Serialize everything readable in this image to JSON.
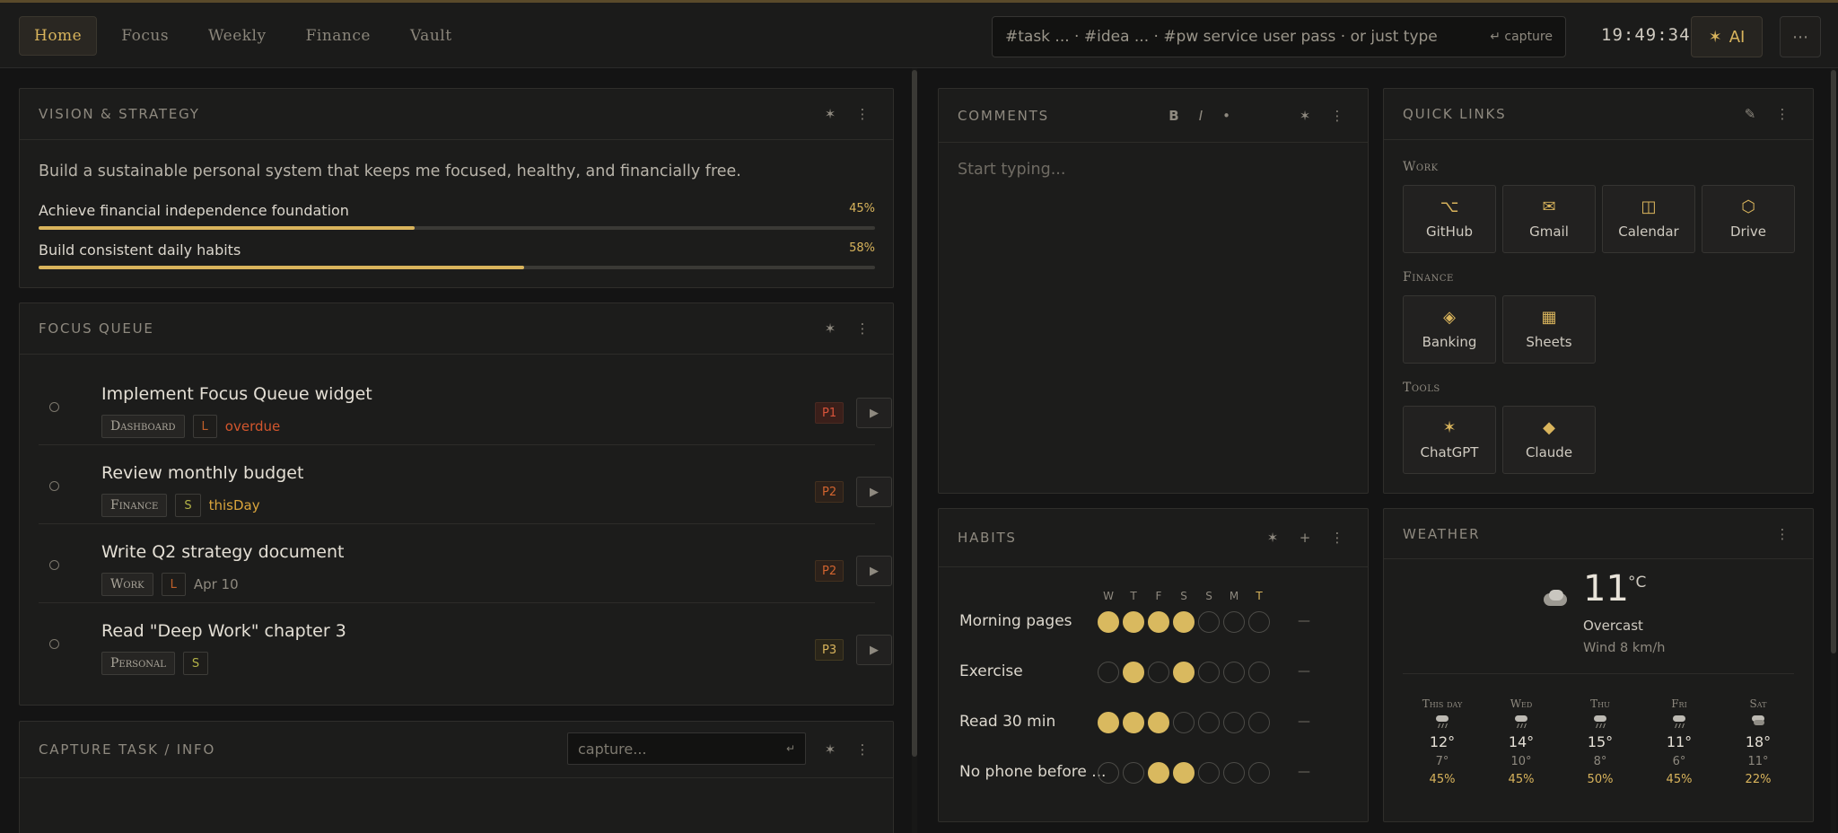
{
  "nav": {
    "tabs": [
      "Home",
      "Focus",
      "Weekly",
      "Finance",
      "Vault"
    ],
    "active": 0
  },
  "command": {
    "placeholder": "#task ... · #idea ... · #pw service user pass · or just type",
    "hint": "↵ capture"
  },
  "clock": "19:49:34",
  "ai_button": {
    "icon": "spark-icon",
    "label": "AI"
  },
  "colors": {
    "accent": "#d9b45c",
    "overdue": "#d2562d",
    "background": "#141414",
    "panel": "#1c1c1b"
  },
  "vision": {
    "title": "Vision & Strategy",
    "statement": "Build a sustainable personal system that keeps me focused, healthy, and financially free.",
    "goals": [
      {
        "label": "Achieve financial independence foundation",
        "pct_label": "45%",
        "progress": 0.45
      },
      {
        "label": "Build consistent daily habits",
        "pct_label": "58%",
        "progress": 0.58
      }
    ]
  },
  "focus": {
    "title": "Focus Queue",
    "tasks": [
      {
        "title": "Implement Focus Queue widget",
        "tag": "Dashboard",
        "size": "L",
        "due": "overdue",
        "due_style": "overdue",
        "priority": "P1"
      },
      {
        "title": "Review monthly budget",
        "tag": "Finance",
        "size": "S",
        "due": "thisDay",
        "due_style": "soon",
        "priority": "P2"
      },
      {
        "title": "Write Q2 strategy document",
        "tag": "Work",
        "size": "L",
        "due": "Apr 10",
        "due_style": "normal",
        "priority": "P2"
      },
      {
        "title": "Read \"Deep Work\" chapter 3",
        "tag": "Personal",
        "size": "S",
        "due": "",
        "due_style": "normal",
        "priority": "P3"
      }
    ]
  },
  "capture": {
    "title": "Capture Task / Info",
    "placeholder": "capture...",
    "hint": "↵"
  },
  "comments": {
    "title": "Comments",
    "format": [
      "B",
      "I",
      "•"
    ],
    "placeholder": "Start typing..."
  },
  "links": {
    "title": "Quick Links",
    "groups": [
      {
        "name": "Work",
        "items": [
          {
            "label": "GitHub",
            "icon": "git-branch-icon"
          },
          {
            "label": "Gmail",
            "icon": "mail-icon"
          },
          {
            "label": "Calendar",
            "icon": "calendar-icon"
          },
          {
            "label": "Drive",
            "icon": "drive-icon"
          }
        ]
      },
      {
        "name": "Finance",
        "items": [
          {
            "label": "Banking",
            "icon": "bank-icon"
          },
          {
            "label": "Sheets",
            "icon": "grid-icon"
          }
        ]
      },
      {
        "name": "Tools",
        "items": [
          {
            "label": "ChatGPT",
            "icon": "spark-icon"
          },
          {
            "label": "Claude",
            "icon": "diamond-icon"
          }
        ]
      }
    ]
  },
  "habits": {
    "title": "Habits",
    "days": [
      "W",
      "T",
      "F",
      "S",
      "S",
      "M",
      "T"
    ],
    "today_index": 6,
    "rows": [
      {
        "name": "Morning pages",
        "done": [
          1,
          1,
          1,
          1,
          0,
          0,
          0
        ],
        "streak": "—"
      },
      {
        "name": "Exercise",
        "done": [
          0,
          1,
          0,
          1,
          0,
          0,
          0
        ],
        "streak": "—"
      },
      {
        "name": "Read 30 min",
        "done": [
          1,
          1,
          1,
          0,
          0,
          0,
          0
        ],
        "streak": "—"
      },
      {
        "name": "No phone before ...",
        "done": [
          0,
          0,
          1,
          1,
          0,
          0,
          0
        ],
        "streak": "—"
      }
    ]
  },
  "weather": {
    "title": "Weather",
    "temp": "11",
    "unit": "°C",
    "condition": "Overcast",
    "wind": "Wind 8 km/h",
    "forecast": [
      {
        "day": "This day",
        "hi": "12°",
        "lo": "7°",
        "precip": "45%",
        "icon": "rain-icon"
      },
      {
        "day": "Wed",
        "hi": "14°",
        "lo": "10°",
        "precip": "45%",
        "icon": "rain-icon"
      },
      {
        "day": "Thu",
        "hi": "15°",
        "lo": "8°",
        "precip": "50%",
        "icon": "rain-icon"
      },
      {
        "day": "Fri",
        "hi": "11°",
        "lo": "6°",
        "precip": "45%",
        "icon": "rain-icon"
      },
      {
        "day": "Sat",
        "hi": "18°",
        "lo": "11°",
        "precip": "22%",
        "icon": "cloud-icon"
      }
    ]
  }
}
